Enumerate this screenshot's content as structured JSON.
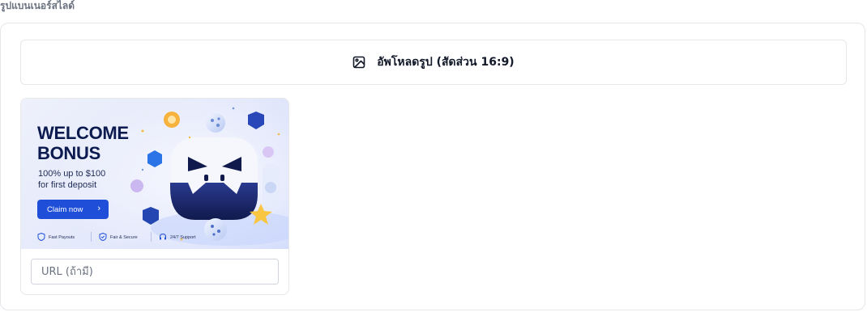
{
  "section": {
    "title": "รูปแบนเนอร์สไลด์"
  },
  "upload": {
    "label": "อัพโหลดรูป (สัดส่วน 16:9)",
    "icon": "image-icon"
  },
  "banner": {
    "headline_line1": "WELCOME",
    "headline_line2": "BONUS",
    "subline1": "100% up to $100",
    "subline2": "for first deposit",
    "cta_label": "Claim now",
    "features": [
      "Fast Payouts",
      "Fair & Secure",
      "24/7 Support"
    ],
    "colors": {
      "cta": "#1f4fd8",
      "headline": "#0b1a4f",
      "background": "#e3e8fb"
    }
  },
  "url_input": {
    "value": "",
    "placeholder": "URL (ถ้ามี)"
  }
}
